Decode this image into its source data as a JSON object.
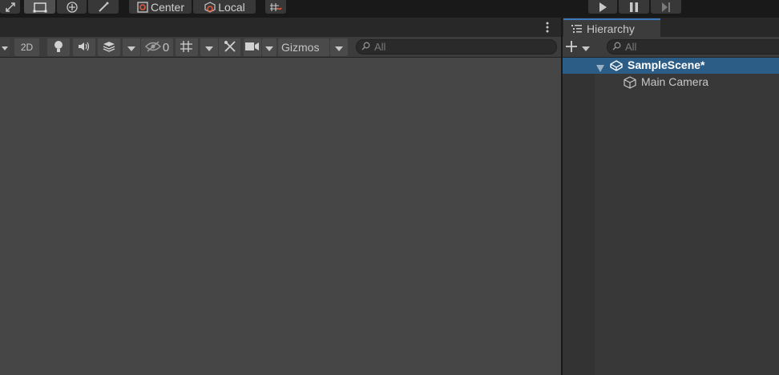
{
  "toolbar": {
    "pivot_mode": "Center",
    "pivot_rotation": "Local"
  },
  "scene": {
    "toolbar": {
      "mode_2d": "2D",
      "hidden_count": "0",
      "gizmos_label": "Gizmos",
      "search_placeholder": "All"
    }
  },
  "hierarchy": {
    "tab_label": "Hierarchy",
    "search_placeholder": "All",
    "items": [
      {
        "label": "SampleScene*",
        "type": "scene",
        "selected": true,
        "expanded": true
      },
      {
        "label": "Main Camera",
        "type": "gameobject",
        "selected": false
      }
    ]
  },
  "colors": {
    "selection": "#2c5d87",
    "tab_accent": "#3a79bb",
    "scene_background": "#464646",
    "panel_background": "#383838"
  }
}
